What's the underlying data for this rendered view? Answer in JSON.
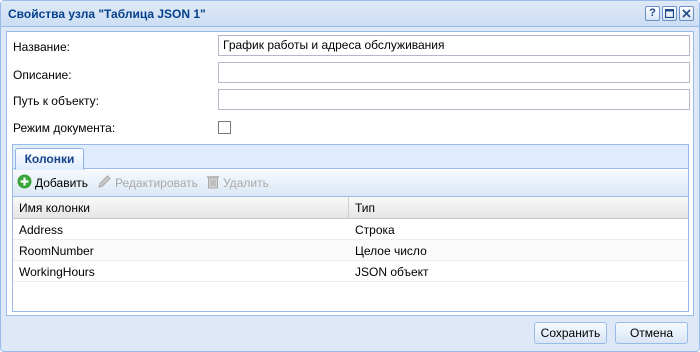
{
  "window": {
    "title": "Свойства узла \"Таблица JSON 1\"",
    "tools": {
      "help_glyph": "?"
    }
  },
  "form": {
    "name_label": "Название:",
    "name_value": "График работы и адреса обслуживания",
    "description_label": "Описание:",
    "description_value": "",
    "path_label": "Путь к объекту:",
    "path_value": "",
    "doc_mode_label": "Режим документа:",
    "doc_mode_checked": false
  },
  "tabs": [
    {
      "label": "Колонки",
      "active": true
    }
  ],
  "toolbar": {
    "add_label": "Добавить",
    "edit_label": "Редактировать",
    "delete_label": "Удалить"
  },
  "grid": {
    "columns": [
      "Имя колонки",
      "Тип"
    ],
    "rows": [
      {
        "name": "Address",
        "type": "Строка"
      },
      {
        "name": "RoomNumber",
        "type": "Целое число"
      },
      {
        "name": "WorkingHours",
        "type": "JSON объект"
      }
    ]
  },
  "buttons": {
    "save_label": "Сохранить",
    "cancel_label": "Отмена"
  },
  "colors": {
    "title_text": "#04408c",
    "tab_text": "#15428b",
    "add_icon": "#3aa53a",
    "disabled_text": "#a9a9a9"
  }
}
